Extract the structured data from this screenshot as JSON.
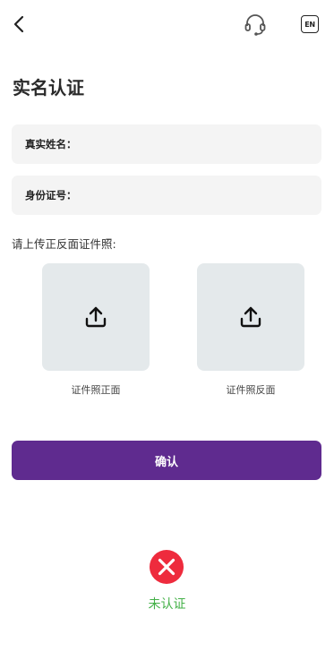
{
  "header": {
    "back_icon": "chevron-left-icon",
    "support_icon": "headset-icon",
    "language_label": "EN"
  },
  "page": {
    "title": "实名认证"
  },
  "form": {
    "name_label": "真实姓名：",
    "name_value": "",
    "id_label": "身份证号：",
    "id_value": ""
  },
  "upload": {
    "prompt": "请上传正反面证件照:",
    "front_caption": "证件照正面",
    "back_caption": "证件照反面",
    "icon": "upload-icon"
  },
  "actions": {
    "confirm_label": "确认"
  },
  "status": {
    "icon": "error-x-icon",
    "text": "未认证"
  },
  "colors": {
    "primary": "#5f2b8f",
    "error": "#ee2b3d",
    "status_text": "#43b047",
    "field_bg": "#f4f4f4",
    "upload_bg": "#e4e9eb"
  }
}
